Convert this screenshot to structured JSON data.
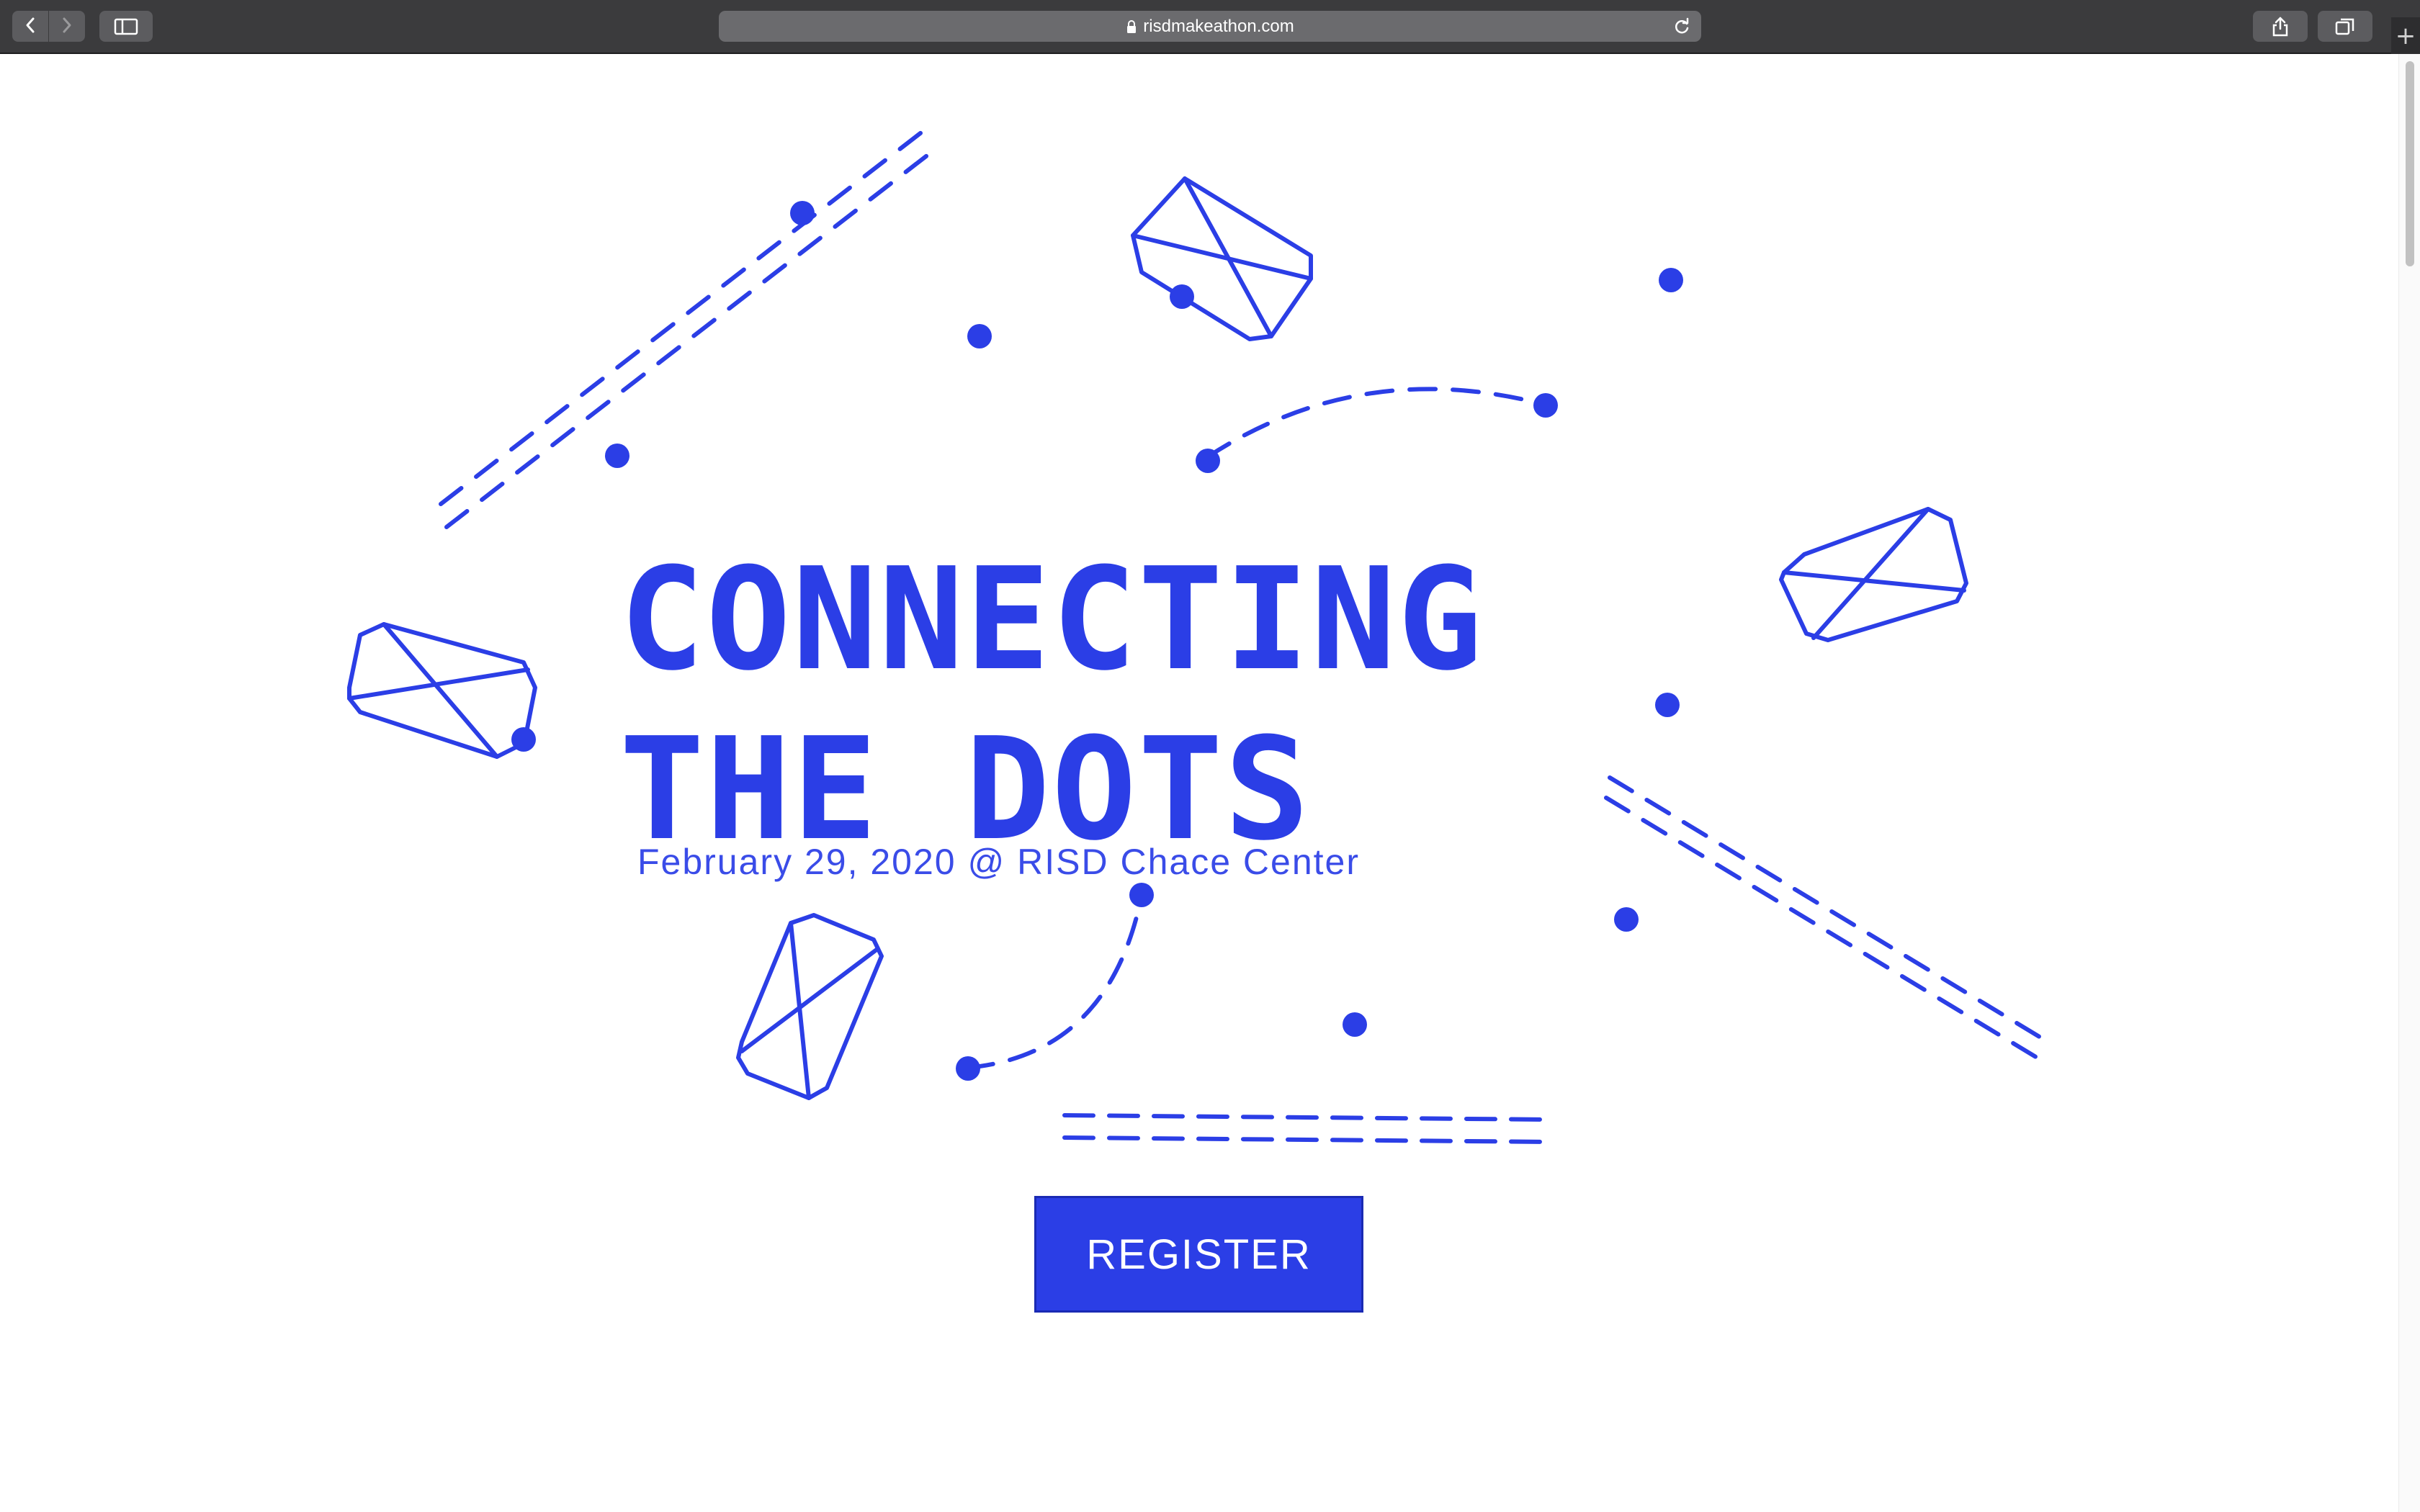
{
  "browser": {
    "url": "risdmakeathon.com",
    "new_tab_label": "+",
    "icons": {
      "back": "chevron-left-icon",
      "forward": "chevron-right-icon",
      "sidebar": "sidebar-icon",
      "lock": "lock-icon",
      "reload": "reload-icon",
      "share": "share-icon",
      "tabs": "tabs-icon"
    }
  },
  "hero": {
    "title_line1": "CONNECTING",
    "title_line2": "THE DOTS",
    "date_location": "February 29, 2020 @ RISD Chace Center",
    "register_label": "REGISTER"
  },
  "colors": {
    "accent": "#2b3ee6",
    "toolbar": "#3b3b3d",
    "background": "#ffffff"
  }
}
